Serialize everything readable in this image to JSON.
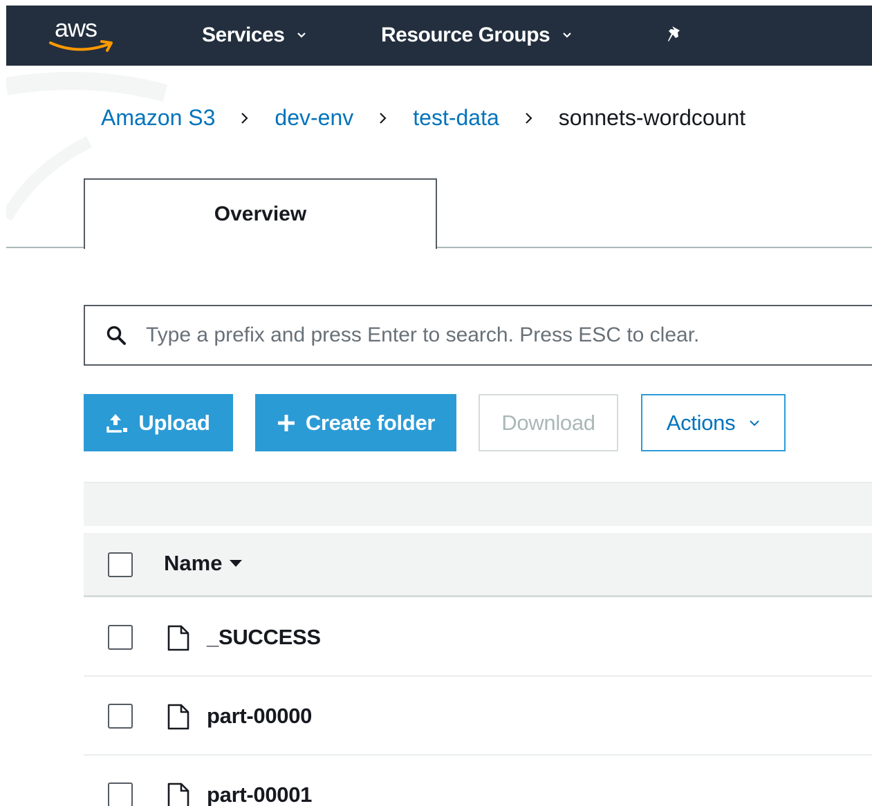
{
  "topnav": {
    "logo_text": "aws",
    "services_label": "Services",
    "resource_groups_label": "Resource Groups",
    "background_color": "#232f3e",
    "logo_accent_color": "#ff9900"
  },
  "breadcrumb": {
    "items": [
      {
        "label": "Amazon S3",
        "link": true
      },
      {
        "label": "dev-env",
        "link": true
      },
      {
        "label": "test-data",
        "link": true
      },
      {
        "label": "sonnets-wordcount",
        "link": false
      }
    ],
    "separator_icon": "chevron-right-icon",
    "link_color": "#0073bb"
  },
  "tabs": [
    {
      "label": "Overview",
      "active": true
    }
  ],
  "search": {
    "placeholder": "Type a prefix and press Enter to search. Press ESC to clear.",
    "value": "",
    "icon": "search-icon"
  },
  "toolbar": {
    "upload_label": "Upload",
    "create_folder_label": "Create folder",
    "download_label": "Download",
    "actions_label": "Actions",
    "primary_color": "#2b9bd6"
  },
  "table": {
    "columns": [
      {
        "label": "Name",
        "sort": "descending"
      }
    ],
    "rows": [
      {
        "name": "_SUCCESS",
        "type": "file"
      },
      {
        "name": "part-00000",
        "type": "file"
      },
      {
        "name": "part-00001",
        "type": "file"
      }
    ]
  }
}
